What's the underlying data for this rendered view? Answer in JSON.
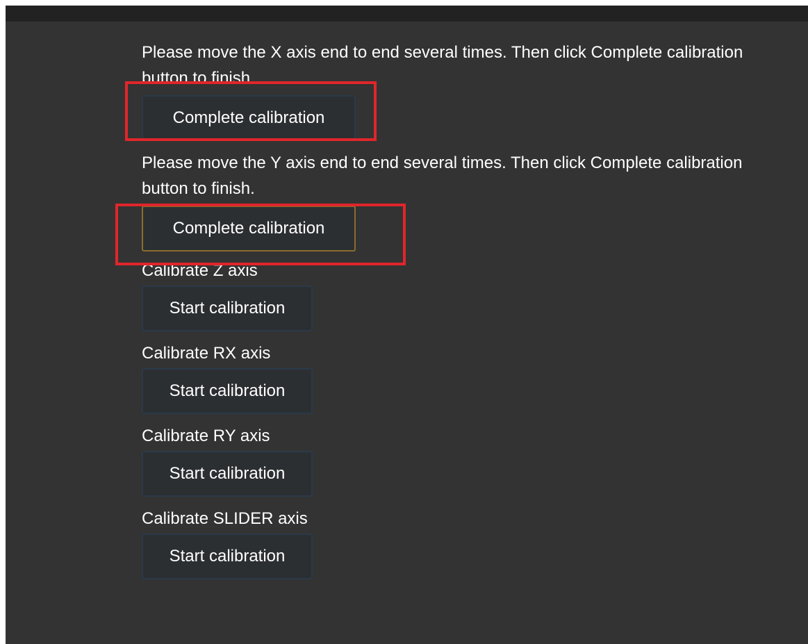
{
  "calibration": {
    "x_axis": {
      "message": "Please move the X axis end to end several times. Then click Complete calibration button to finish.",
      "button_label": "Complete calibration"
    },
    "y_axis": {
      "message": "Please move the Y axis end to end several times. Then click Complete calibration button to finish.",
      "button_label": "Complete calibration"
    },
    "z_axis": {
      "label": "Calibrate Z axis",
      "button_label": "Start calibration"
    },
    "rx_axis": {
      "label": "Calibrate RX axis",
      "button_label": "Start calibration"
    },
    "ry_axis": {
      "label": "Calibrate RY axis",
      "button_label": "Start calibration"
    },
    "slider_axis": {
      "label": "Calibrate SLIDER axis",
      "button_label": "Start calibration"
    }
  },
  "colors": {
    "background": "#333333",
    "topbar": "#222222",
    "text": "#ffffff",
    "button_bg": "#2c2f32",
    "focused_border": "#8a6d2e",
    "highlight": "#e0262b"
  }
}
